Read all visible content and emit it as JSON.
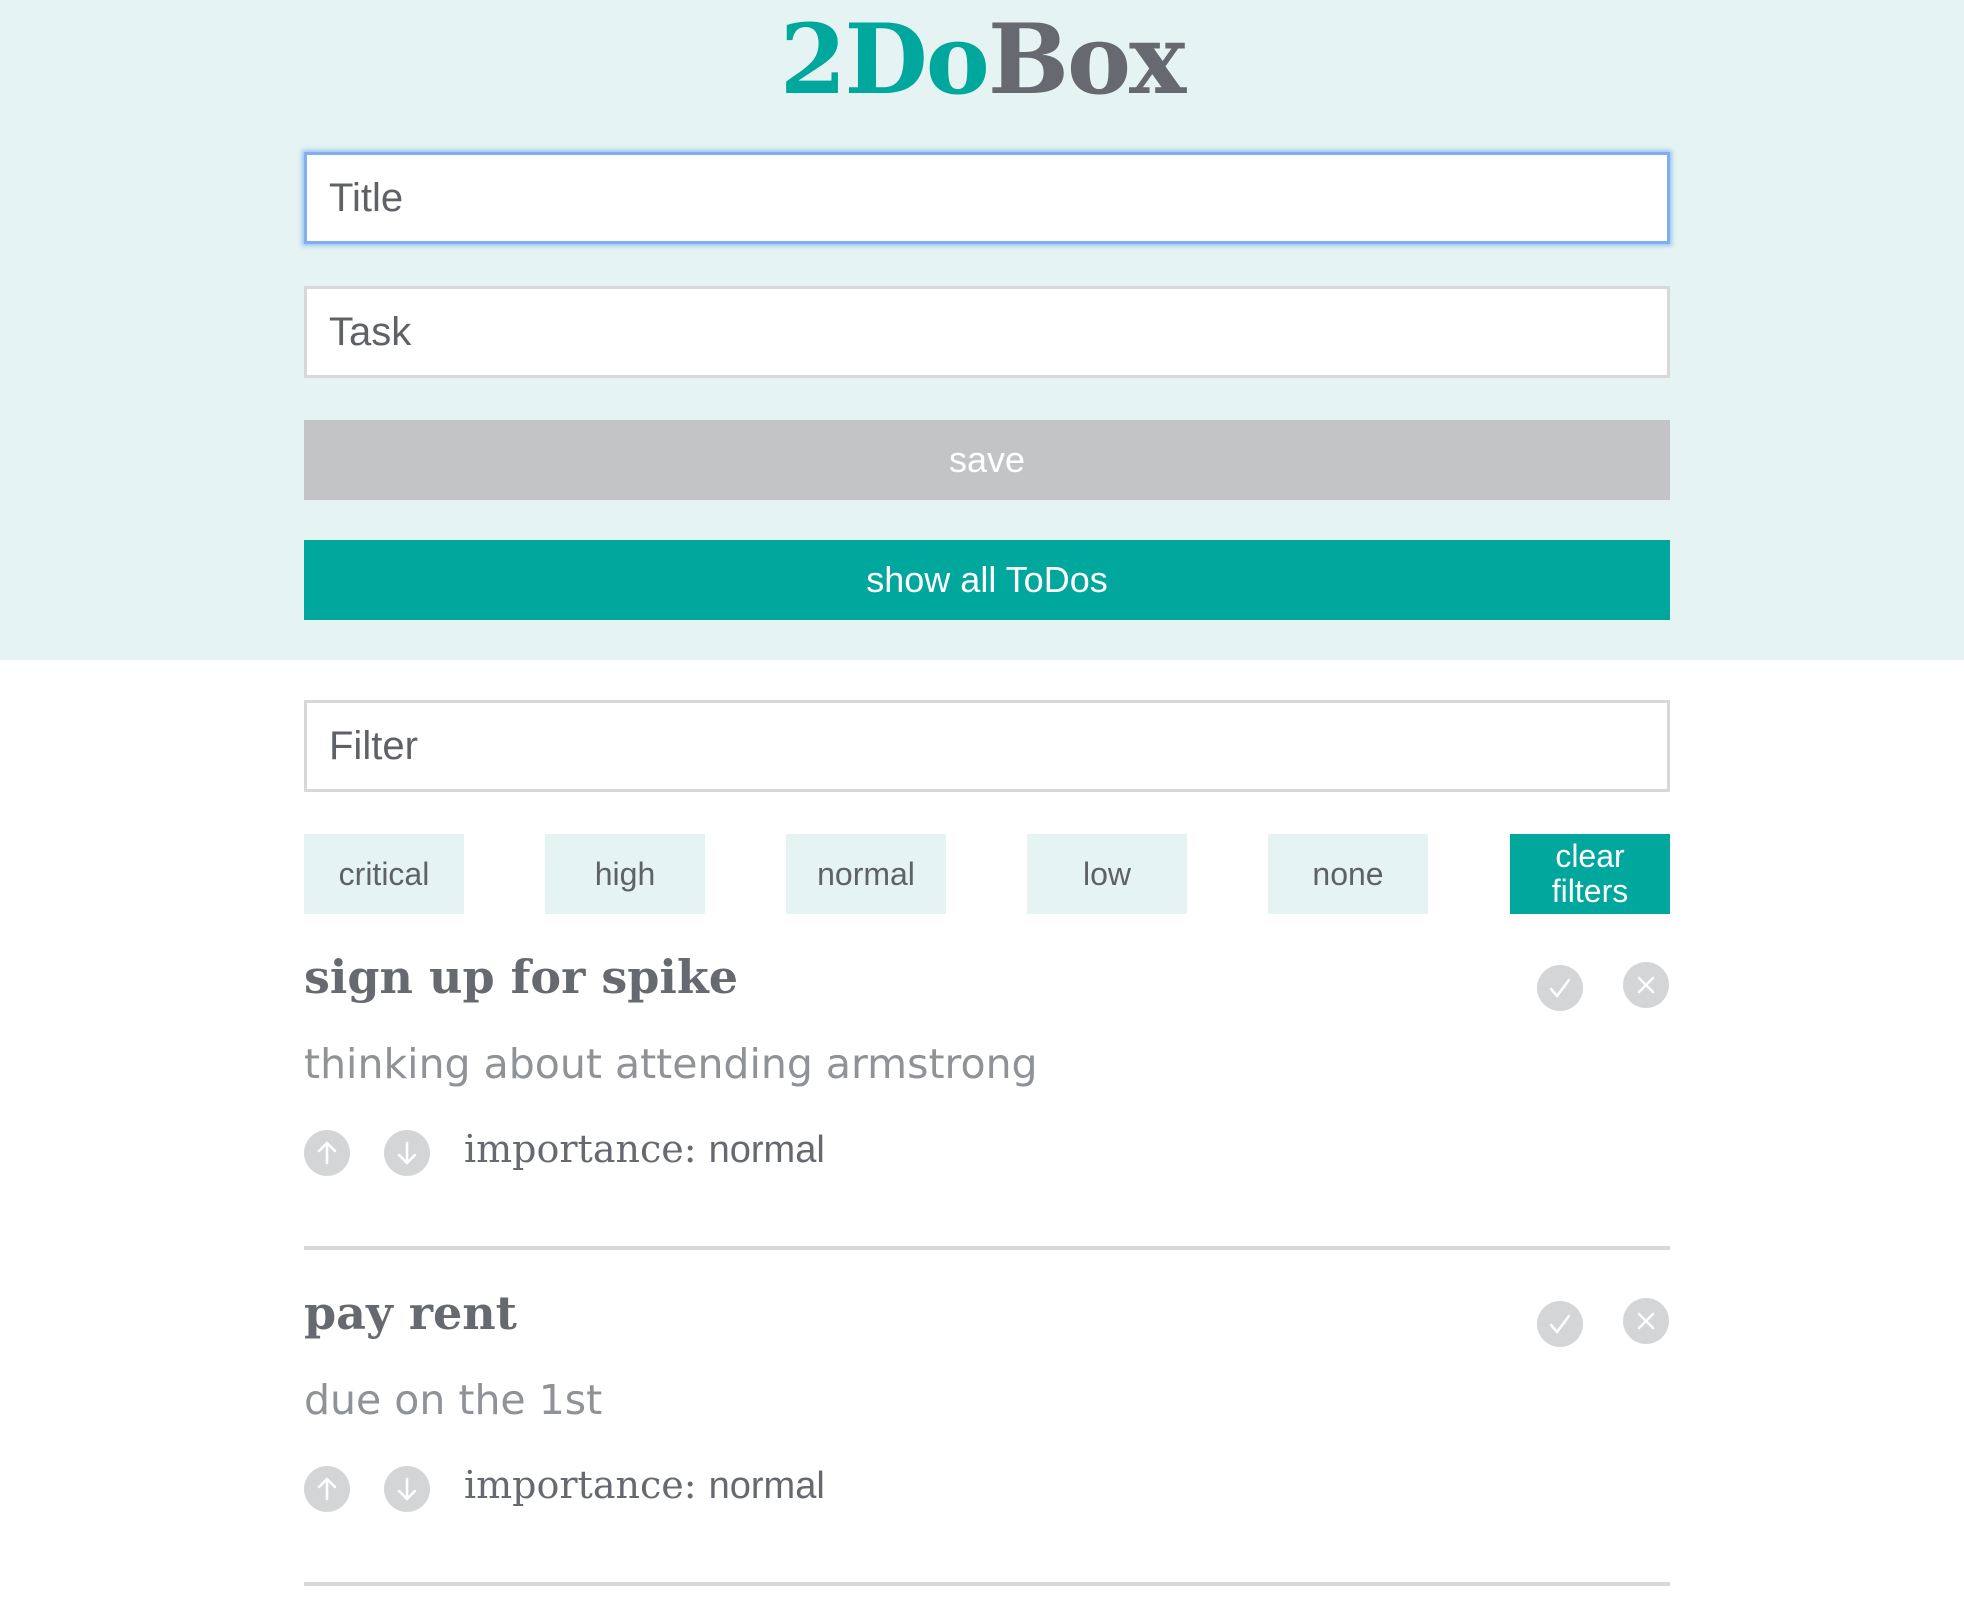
{
  "app": {
    "logo_part1": "2Do",
    "logo_part2": "Box"
  },
  "form": {
    "title_placeholder": "Title",
    "task_placeholder": "Task",
    "save_label": "save",
    "show_all_label": "show all ToDos"
  },
  "filter": {
    "placeholder": "Filter",
    "chips": [
      "critical",
      "high",
      "normal",
      "low",
      "none"
    ],
    "clear_line1": "clear",
    "clear_line2": "filters"
  },
  "todos": [
    {
      "title": "sign up for spike",
      "body": "thinking about attending armstrong",
      "importance_label": "importance:",
      "importance_value": "normal"
    },
    {
      "title": "pay rent",
      "body": "due on the 1st",
      "importance_label": "importance:",
      "importance_value": "normal"
    }
  ],
  "colors": {
    "accent": "#00a79d",
    "header_bg": "#e5f3f2",
    "logo_secondary": "#666a70",
    "save_disabled": "#c3c4c6",
    "icon_gray": "#d4d5d6"
  }
}
